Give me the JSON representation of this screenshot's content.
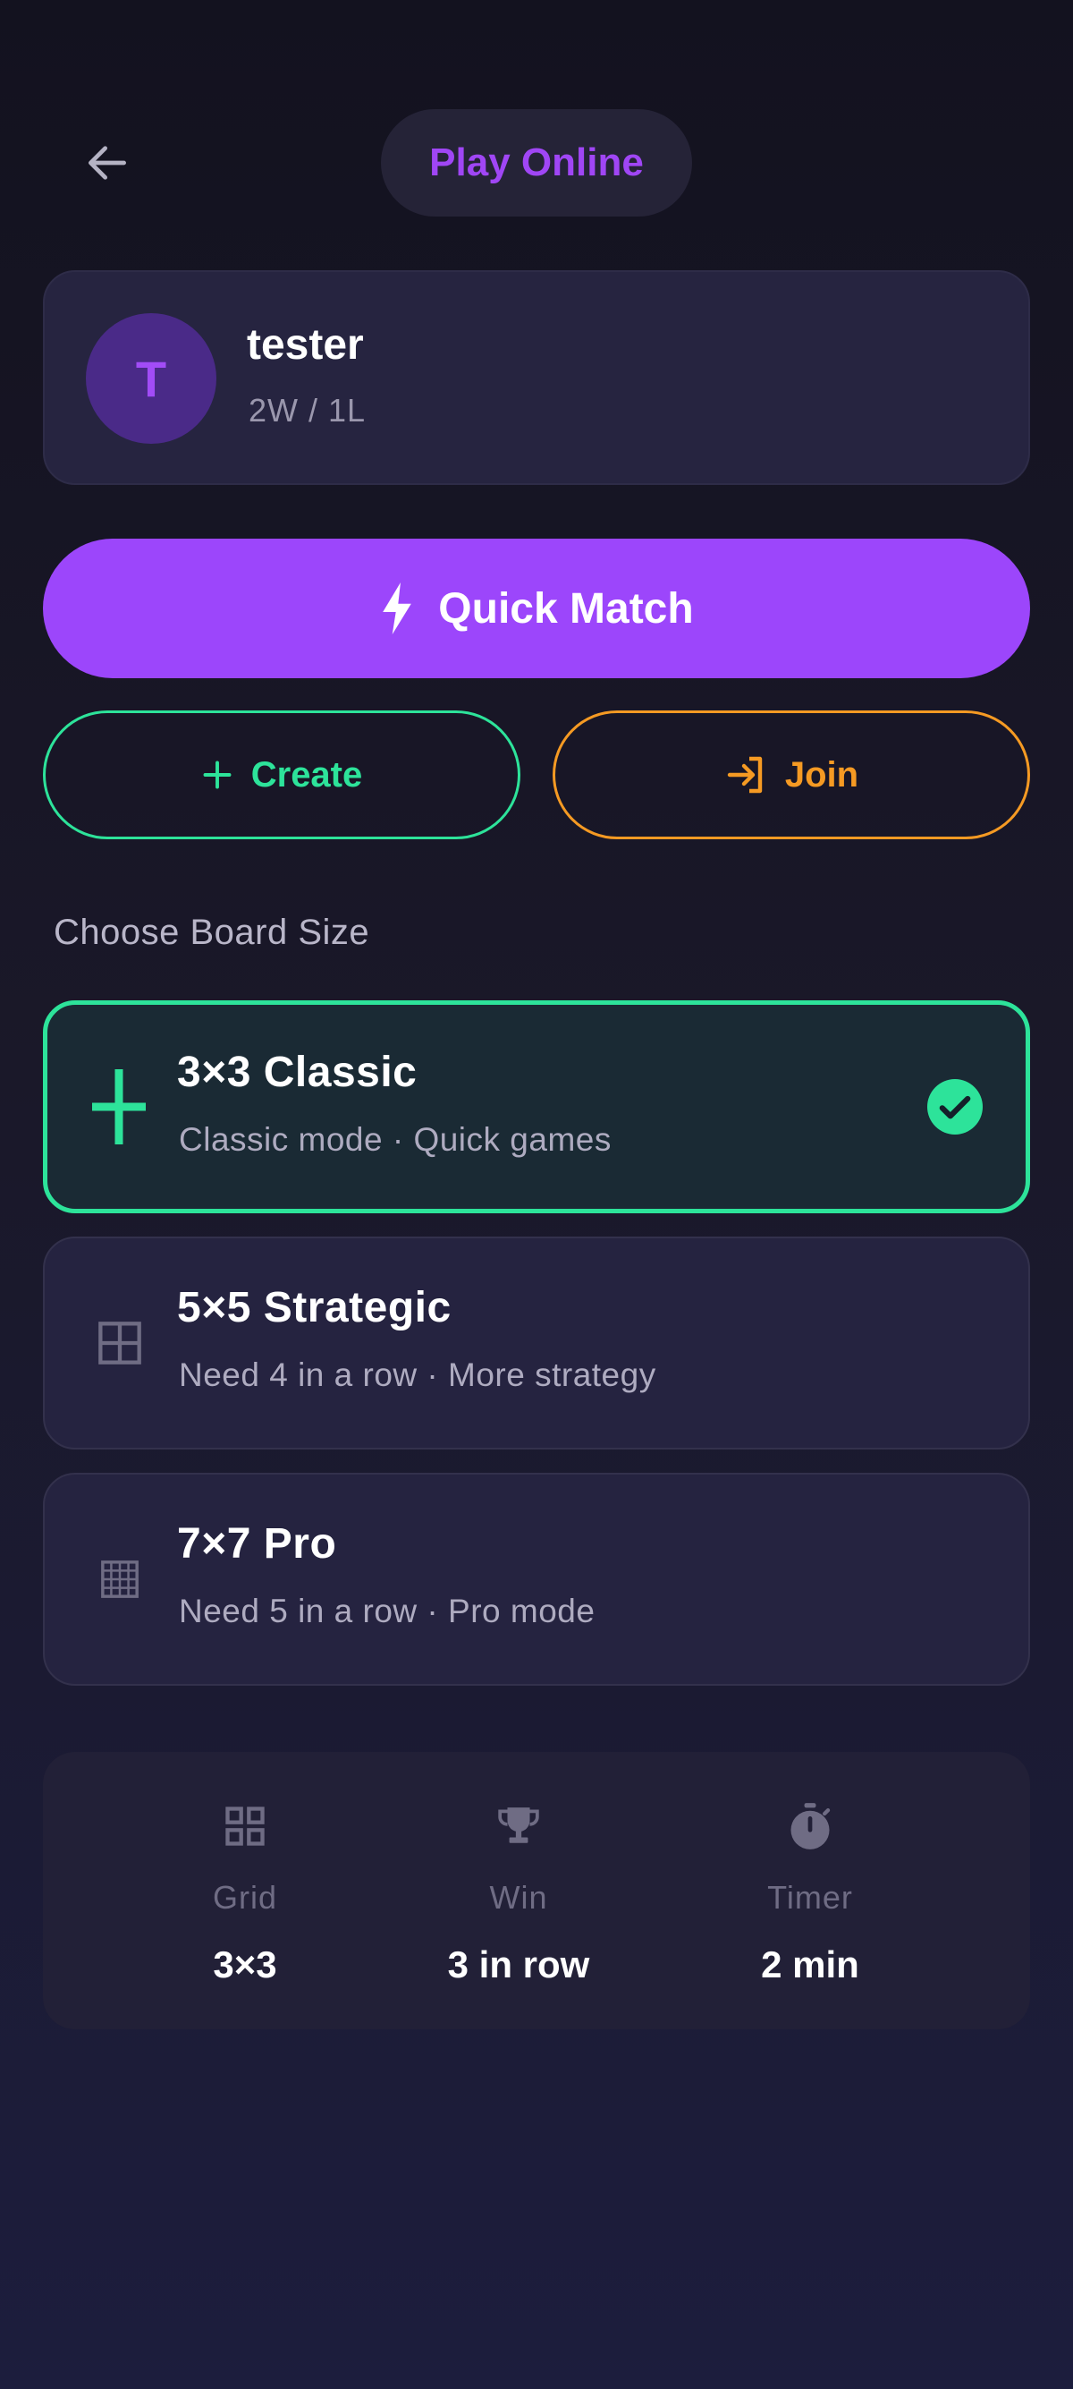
{
  "header": {
    "title": "Play Online"
  },
  "profile": {
    "avatar_initial": "T",
    "name": "tester",
    "record": "2W / 1L"
  },
  "actions": {
    "quick_match_label": "Quick Match",
    "create_label": "Create",
    "join_label": "Join"
  },
  "board_section": {
    "label": "Choose Board Size",
    "options": [
      {
        "title": "3×3 Classic",
        "description": "Classic mode · Quick games",
        "selected": true,
        "icon": "plus-icon"
      },
      {
        "title": "5×5 Strategic",
        "description": "Need 4 in a row · More strategy",
        "selected": false,
        "icon": "grid-2x2-icon"
      },
      {
        "title": "7×7 Pro",
        "description": "Need 5 in a row · Pro mode",
        "selected": false,
        "icon": "grid-dense-icon"
      }
    ]
  },
  "info": [
    {
      "icon": "grid-icon",
      "label": "Grid",
      "value": "3×3"
    },
    {
      "icon": "trophy-icon",
      "label": "Win",
      "value": "3 in row"
    },
    {
      "icon": "stopwatch-icon",
      "label": "Timer",
      "value": "2 min"
    }
  ],
  "colors": {
    "accent_purple": "#9c46fb",
    "accent_green": "#2de39a",
    "accent_orange": "#f59a23"
  }
}
